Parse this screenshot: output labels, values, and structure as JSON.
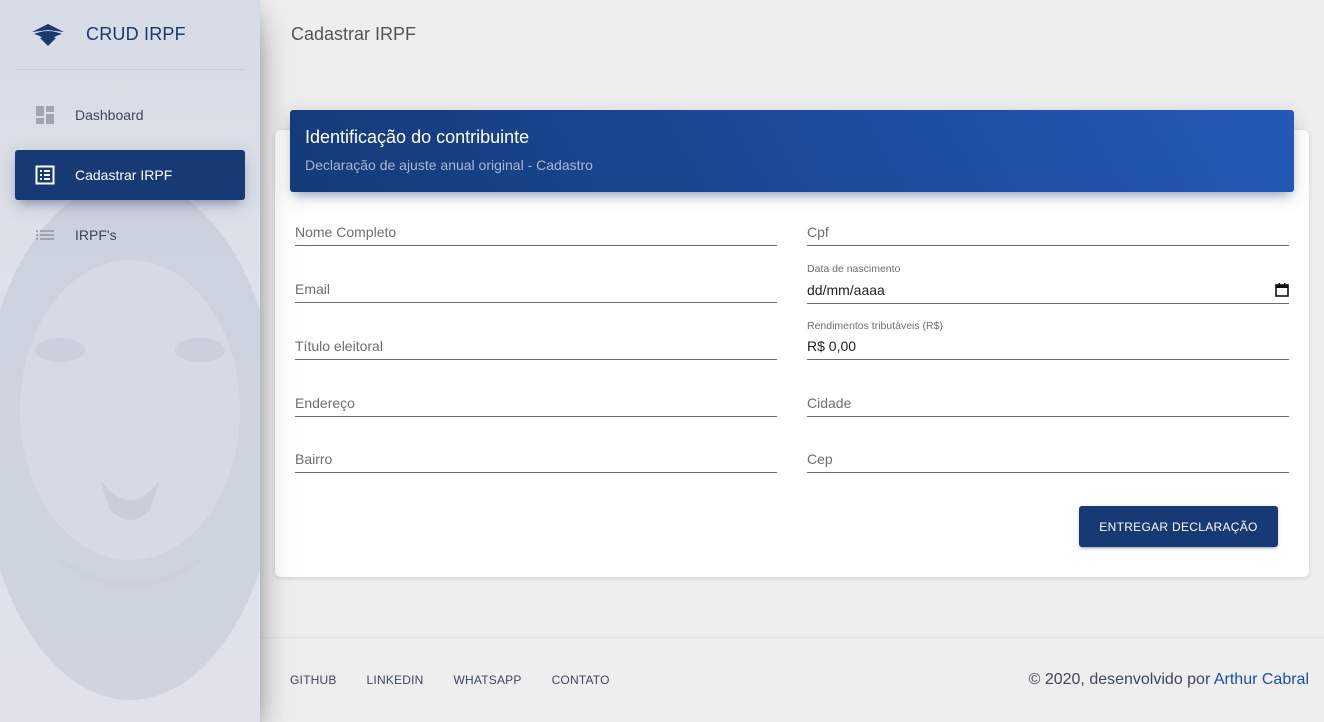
{
  "sidebar": {
    "brand": "CRUD IRPF",
    "items": [
      {
        "label": "Dashboard",
        "icon": "dashboard-icon",
        "active": false
      },
      {
        "label": "Cadastrar IRPF",
        "icon": "list-alt-icon",
        "active": true
      },
      {
        "label": "IRPF's",
        "icon": "list-icon",
        "active": false
      }
    ]
  },
  "header": {
    "page_title": "Cadastrar IRPF"
  },
  "card": {
    "title": "Identificação do contribuinte",
    "subtitle": "Declaração de ajuste anual original - Cadastro"
  },
  "form": {
    "nome_placeholder": "Nome Completo",
    "cpf_placeholder": "Cpf",
    "email_placeholder": "Email",
    "nascimento_label": "Data de nascimento",
    "nascimento_value": "dd/mm/aaaa",
    "titulo_placeholder": "Título eleitoral",
    "rendimentos_label": "Rendimentos tributáveis (R$)",
    "rendimentos_value": "R$ 0,00",
    "endereco_placeholder": "Endereço",
    "cidade_placeholder": "Cidade",
    "bairro_placeholder": "Bairro",
    "cep_placeholder": "Cep",
    "submit_label": "ENTREGAR DECLARAÇÃO"
  },
  "footer": {
    "links": [
      "GITHUB",
      "LINKEDIN",
      "WHATSAPP",
      "CONTATO"
    ],
    "copyright_prefix": "© 2020, desenvolvido por",
    "author": "Arthur Cabral"
  },
  "colors": {
    "primary": "#173a75",
    "accent_gradient_end": "#2459b8",
    "link": "#1e4fa3"
  }
}
